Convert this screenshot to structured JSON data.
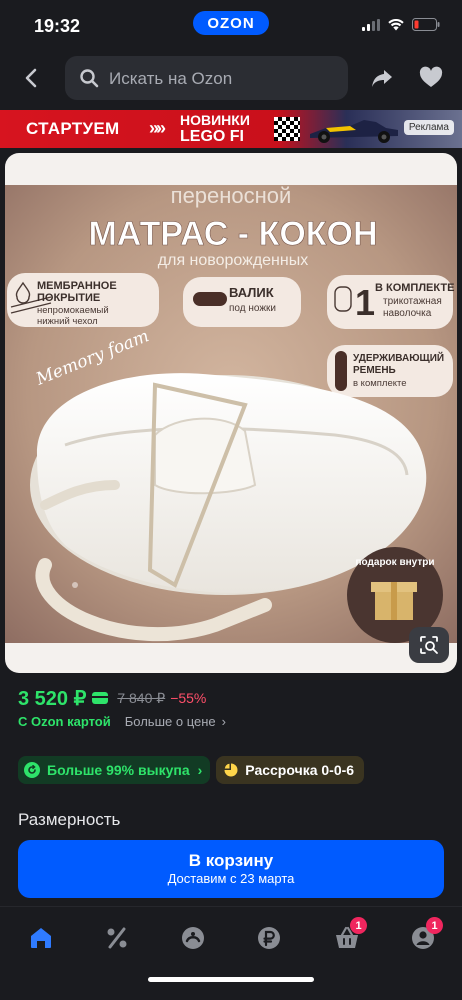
{
  "status_bar": {
    "time": "19:32",
    "logo": "OZON"
  },
  "header": {
    "search_placeholder": "Искать на Ozon"
  },
  "banner": {
    "start": "СТАРТУЕМ",
    "arrows": "»»",
    "line1": "НОВИНКИ",
    "line2": "LEGO FI",
    "ad_label": "Реклама"
  },
  "product_image": {
    "title_small": "переносной",
    "title_big": "МАТРАС - КОКОН",
    "title_sub": "для новорожденных",
    "feature1_title1": "МЕМБРАННОЕ",
    "feature1_title2": "ПОКРЫТИЕ",
    "feature1_desc1": "непромокаемый",
    "feature1_desc2": "нижний чехол",
    "feature2_title": "ВАЛИК",
    "feature2_desc": "под ножки",
    "feature3_num": "1",
    "feature3_title": "В КОМПЛЕКТЕ",
    "feature3_desc1": "трикотажная",
    "feature3_desc2": "наволочка",
    "feature4_title1": "УДЕРЖИВАЮЩИЙ",
    "feature4_title2": "РЕМЕНЬ",
    "feature4_desc": "в комплекте",
    "memory_foam": "Memory foam",
    "gift": "подарок внутри"
  },
  "price": {
    "current": "3 520 ₽",
    "old": "7 840 ₽",
    "discount": "−55%"
  },
  "ozon_card": {
    "label": "С Ozon картой",
    "more": "Больше о цене",
    "chevron": "›"
  },
  "badges": {
    "buyout": "Больше 99% выкупа",
    "buyout_chevron": "›",
    "installment_prefix": "Рассрочка",
    "installment_value": "0-0-6"
  },
  "size_label": "Размерность",
  "cart_button": {
    "title": "В корзину",
    "subtitle": "Доставим с 23 марта"
  },
  "bottom_nav": {
    "cart_badge": "1",
    "profile_badge": "1"
  },
  "colors": {
    "accent": "#005bff",
    "price_green": "#2ee36a",
    "discount_red": "#ff4f6a",
    "badge_pink": "#f0265e"
  }
}
